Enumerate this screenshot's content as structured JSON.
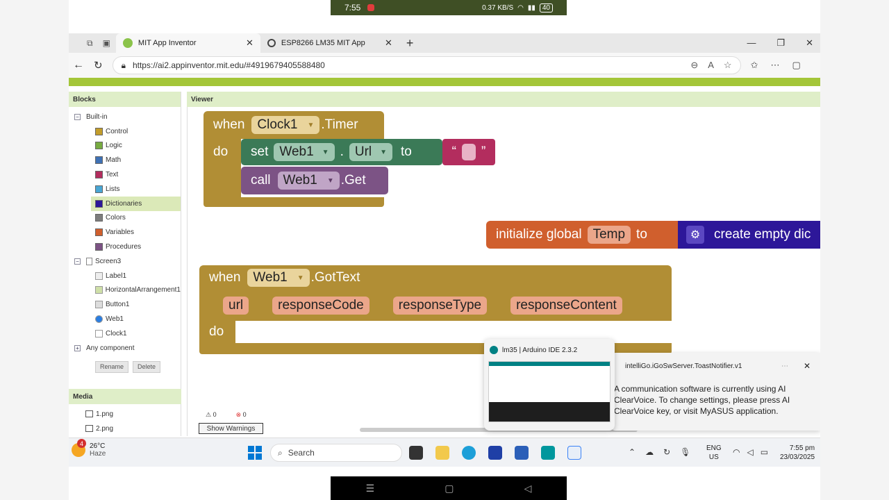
{
  "phone": {
    "time": "7:55",
    "speed": "0.37 KB/S",
    "battery": "40"
  },
  "browser": {
    "tabs": [
      {
        "label": "MIT App Inventor"
      },
      {
        "label": "ESP8266 LM35 MIT App"
      }
    ],
    "url": "https://ai2.appinventor.mit.edu/#4919679405588480"
  },
  "blocks_panel": {
    "title": "Blocks",
    "builtin_label": "Built-in",
    "builtin_items": [
      {
        "label": "Control",
        "color": "#c39d2b"
      },
      {
        "label": "Logic",
        "color": "#77ab41"
      },
      {
        "label": "Math",
        "color": "#3f71b5"
      },
      {
        "label": "Text",
        "color": "#b32d5e"
      },
      {
        "label": "Lists",
        "color": "#49a6d4"
      },
      {
        "label": "Dictionaries",
        "color": "#2d1799"
      },
      {
        "label": "Colors",
        "color": "#7d7d7d"
      },
      {
        "label": "Variables",
        "color": "#d05f2d"
      },
      {
        "label": "Procedures",
        "color": "#7c5385"
      }
    ],
    "screen_label": "Screen3",
    "components": [
      "Label1",
      "HorizontalArrangement1",
      "Button1",
      "Web1",
      "Clock1"
    ],
    "any_component": "Any component",
    "rename": "Rename",
    "delete": "Delete"
  },
  "media": {
    "title": "Media",
    "files": [
      "1.png",
      "2.png"
    ]
  },
  "viewer": {
    "title": "Viewer",
    "warnings_count": "0",
    "errors_count": "0",
    "show_warnings": "Show Warnings"
  },
  "blocks": {
    "timer_when": "when",
    "timer_component": "Clock1",
    "timer_event": ".Timer",
    "do": "do",
    "set": "set",
    "set_component": "Web1",
    "dot": ".",
    "set_prop": "Url",
    "to": "to",
    "text_open": "“",
    "text_close": "”",
    "call": "call",
    "call_component": "Web1",
    "call_method": ".Get",
    "init_global": "initialize global",
    "var_name": "Temp",
    "init_to": "to",
    "create_dict": "create empty dic",
    "gottext_when": "when",
    "gottext_component": "Web1",
    "gottext_event": ".GotText",
    "params": [
      "url",
      "responseCode",
      "responseType",
      "responseContent"
    ],
    "gottext_do": "do"
  },
  "taskbar": {
    "weather_temp": "26°C",
    "weather_desc": "Haze",
    "weather_badge": "4",
    "search": "Search",
    "lang": "ENG",
    "region": "US",
    "clock_time": "7:55 pm",
    "clock_date": "23/03/2025"
  },
  "hover_preview": {
    "title": "lm35 | Arduino IDE 2.3.2"
  },
  "toast": {
    "app": "intelliGo.iGoSwServer.ToastNotifier.v1",
    "message": "A communication software is currently using AI ClearVoice. To change settings, please press AI ClearVoice key, or visit MyASUS application."
  }
}
